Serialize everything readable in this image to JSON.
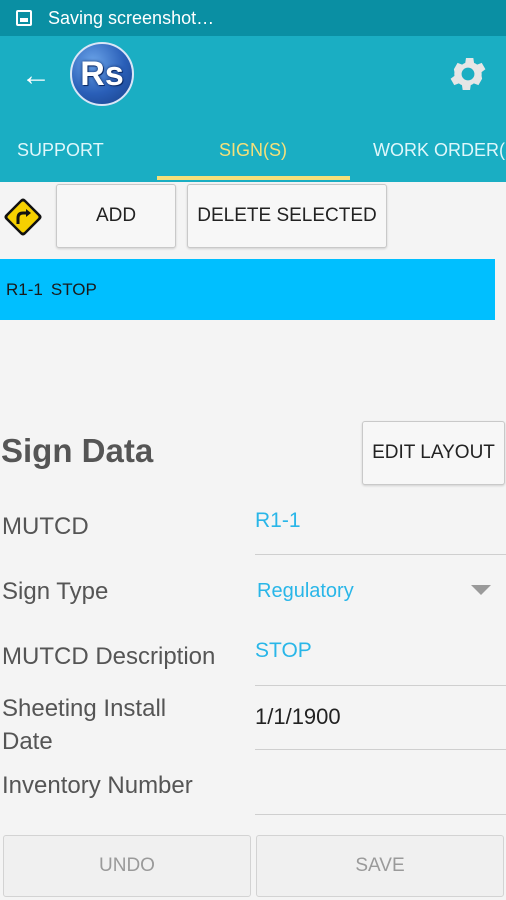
{
  "status_bar": {
    "text": "Saving screenshot…"
  },
  "app_bar": {
    "logo_text": "Rs",
    "back_icon": "arrow-left-icon",
    "settings_icon": "gear-icon"
  },
  "tabs": [
    {
      "label": "SUPPORT",
      "active": false
    },
    {
      "label": "SIGN(S)",
      "active": true
    },
    {
      "label": "WORK ORDER(S)",
      "active": false
    }
  ],
  "toolbar": {
    "add_label": "ADD",
    "delete_label": "DELETE SELECTED",
    "sign_icon": "curve-right-warning-sign-icon"
  },
  "sign_list": [
    {
      "code": "R1-1",
      "name": "STOP",
      "selected": true
    }
  ],
  "sign_data": {
    "title": "Sign Data",
    "edit_layout_label": "EDIT LAYOUT",
    "fields": {
      "mutcd": {
        "label": "MUTCD",
        "value": "R1-1"
      },
      "sign_type": {
        "label": "Sign Type",
        "value": "Regulatory"
      },
      "mutcd_description": {
        "label": "MUTCD Description",
        "value": "STOP"
      },
      "sheeting_install_date": {
        "label_line1": "Sheeting Install",
        "label_line2": "Date",
        "value": "1/1/1900"
      },
      "inventory_number": {
        "label": "Inventory Number",
        "value": ""
      }
    }
  },
  "footer": {
    "undo_label": "UNDO",
    "save_label": "SAVE"
  },
  "colors": {
    "status_bar": "#0a8fa3",
    "app_bar": "#1aaec3",
    "tab_active": "#f5e07a",
    "selected_row": "#00bfff",
    "field_value": "#29b6e8"
  }
}
